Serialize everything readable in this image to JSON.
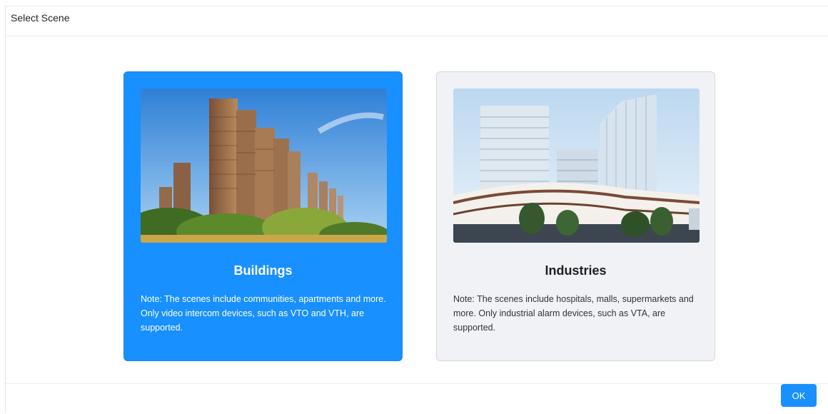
{
  "dialog": {
    "title": "Select Scene",
    "ok_label": "OK"
  },
  "scenes": [
    {
      "title": "Buildings",
      "note": "Note: The scenes include communities, apartments and more. Only video intercom devices, such as VTO and VTH, are supported.",
      "selected": true
    },
    {
      "title": "Industries",
      "note": "Note: The scenes include hospitals, malls, supermarkets and more. Only industrial alarm devices, such as VTA, are supported.",
      "selected": false
    }
  ],
  "colors": {
    "accent": "#1890ff",
    "card_unselected_bg": "#f1f2f6"
  }
}
